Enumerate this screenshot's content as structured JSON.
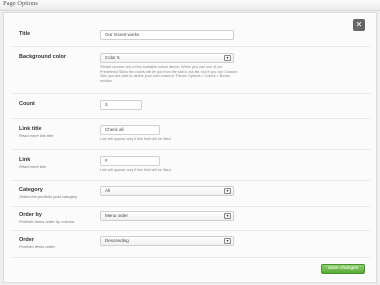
{
  "header": {
    "title": "Page Options"
  },
  "close_icon": "close-icon",
  "fields": {
    "title": {
      "label": "Title",
      "value": "Our recent works"
    },
    "background": {
      "label": "Background color",
      "value": "Color 5",
      "help": "Please choose one of the available colors above. When you use one of our Predefined Skins the colors will be got from the skin's css file, but if you use Custom Skin you are able to define your own colors in Theme Options > Colors > Boxes section."
    },
    "count": {
      "label": "Count",
      "value": "3"
    },
    "link_title": {
      "label": "Link title",
      "sublabel": "Read more link title",
      "value": "Check all",
      "help": "Link will appear only if this field will be filled."
    },
    "link": {
      "label": "Link",
      "sublabel": "Read more link",
      "value": "#",
      "help": "Link will appear only if this field will be filled."
    },
    "category": {
      "label": "Category",
      "sublabel": "Select the portfolio post category",
      "value": "All"
    },
    "order_by": {
      "label": "Order by",
      "sublabel": "Portfolio items order by column.",
      "value": "Menu order"
    },
    "order": {
      "label": "Order",
      "sublabel": "Portfolio items order.",
      "value": "Descending"
    }
  },
  "actions": {
    "save_label": "Save changes"
  }
}
